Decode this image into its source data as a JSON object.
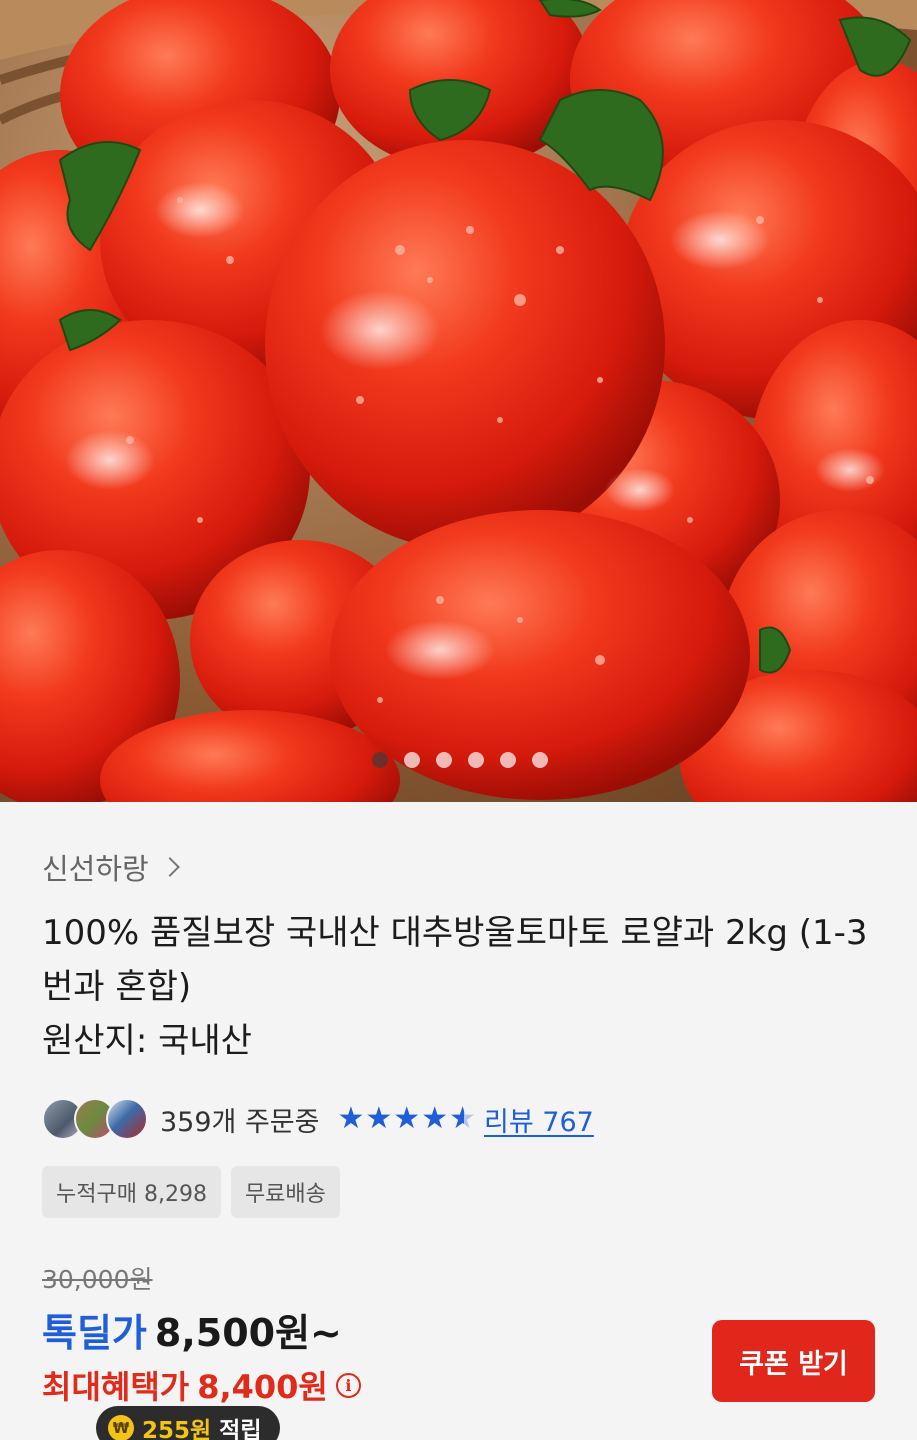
{
  "gallery": {
    "image_alt": "tomatoes",
    "slide_count": 6,
    "active_index": 0
  },
  "product": {
    "seller": "신선하랑",
    "title": "100% 품질보장 국내산 대추방울토마토 로얄과 2kg (1-3번과 혼합)",
    "origin": "원산지: 국내산",
    "orders_text": "359개 주문중",
    "rating": 4.5,
    "review_text": "리뷰 767",
    "badges": [
      "누적구매 8,298",
      "무료배송"
    ]
  },
  "pricing": {
    "original_price": "30,000원",
    "deal_label": "톡딜가",
    "deal_price": "8,500원~",
    "max_label": "최대혜택가",
    "max_price": "8,400원",
    "points_amount": "255원",
    "points_label": "적립",
    "coin_symbol": "₩"
  },
  "actions": {
    "coupon_label": "쿠폰 받기"
  },
  "colors": {
    "accent_blue": "#1f5ed8",
    "accent_red": "#e1261c",
    "points_yellow": "#f3c316"
  }
}
